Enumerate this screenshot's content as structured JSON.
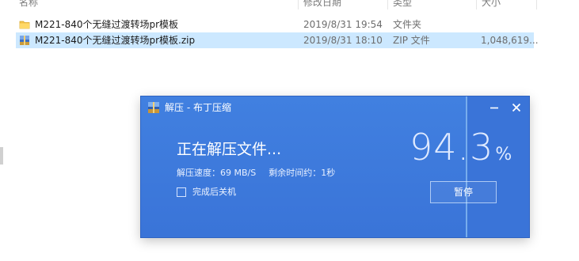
{
  "explorer": {
    "columns": {
      "name": "名称",
      "date": "修改日期",
      "type": "类型",
      "size": "大小"
    },
    "files": [
      {
        "name": "M221-840个无缝过渡转场pr模板",
        "date": "2019/8/31 19:54",
        "type": "文件夹",
        "size": "",
        "icon": "folder-icon"
      },
      {
        "name": "M221-840个无缝过渡转场pr模板.zip",
        "date": "2019/8/31 18:10",
        "type": "ZIP 文件",
        "size": "1,048,619...",
        "icon": "zip-archive-icon",
        "selected": true
      }
    ]
  },
  "dialog": {
    "title": "解压 - 布丁压缩",
    "status": "正在解压文件...",
    "speed_label": "解压速度：",
    "speed_value": "69 MB/S",
    "remaining_label": "剩余时间约：",
    "remaining_value": "1秒",
    "shutdown_label": "完成后关机",
    "shutdown_checked": false,
    "progress_value": "94.3",
    "progress_unit": "%",
    "progress_fraction": 0.943,
    "pause_label": "暂停",
    "icons": {
      "app": "app-logo-icon",
      "minimize": "minimize-icon",
      "close": "close-icon"
    },
    "colors": {
      "background": "#3a74d8",
      "accent_line": "#aadcff"
    }
  }
}
